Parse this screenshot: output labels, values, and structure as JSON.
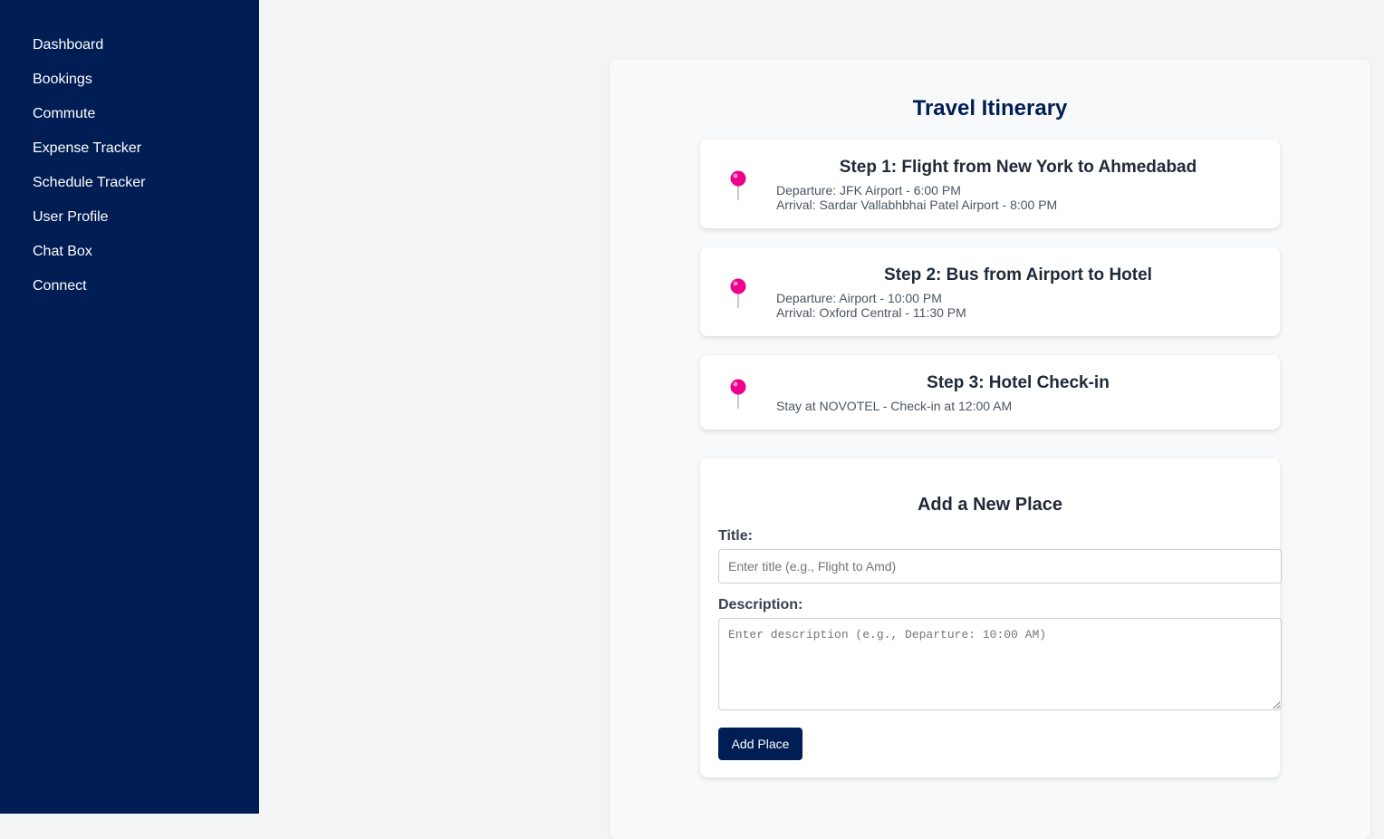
{
  "sidebar": {
    "items": [
      {
        "label": "Dashboard"
      },
      {
        "label": "Bookings"
      },
      {
        "label": "Commute"
      },
      {
        "label": "Expense Tracker"
      },
      {
        "label": "Schedule Tracker"
      },
      {
        "label": "User Profile"
      },
      {
        "label": "Chat Box"
      },
      {
        "label": "Connect"
      }
    ]
  },
  "itinerary": {
    "title": "Travel Itinerary",
    "steps": [
      {
        "title": "Step 1: Flight from New York to Ahmedabad",
        "line1": "Departure: JFK Airport - 6:00 PM",
        "line2": "Arrival: Sardar Vallabhbhai Patel Airport - 8:00 PM",
        "icon": "pin-icon"
      },
      {
        "title": "Step 2: Bus from Airport to Hotel",
        "line1": "Departure: Airport - 10:00 PM",
        "line2": "Arrival: Oxford Central - 11:30 PM",
        "icon": "pin-icon"
      },
      {
        "title": "Step 3: Hotel Check-in",
        "line1": "Stay at NOVOTEL - Check-in at 12:00 AM",
        "icon": "pin-icon"
      }
    ]
  },
  "form": {
    "title": "Add a New Place",
    "title_label": "Title:",
    "title_placeholder": "Enter title (e.g., Flight to Amd)",
    "title_value": "",
    "description_label": "Description:",
    "description_placeholder": "Enter description (e.g., Departure: 10:00 AM)",
    "description_value": "",
    "submit_label": "Add Place"
  },
  "colors": {
    "sidebar_bg": "#001d54",
    "accent": "#001d54",
    "pin": "#ec008c"
  }
}
